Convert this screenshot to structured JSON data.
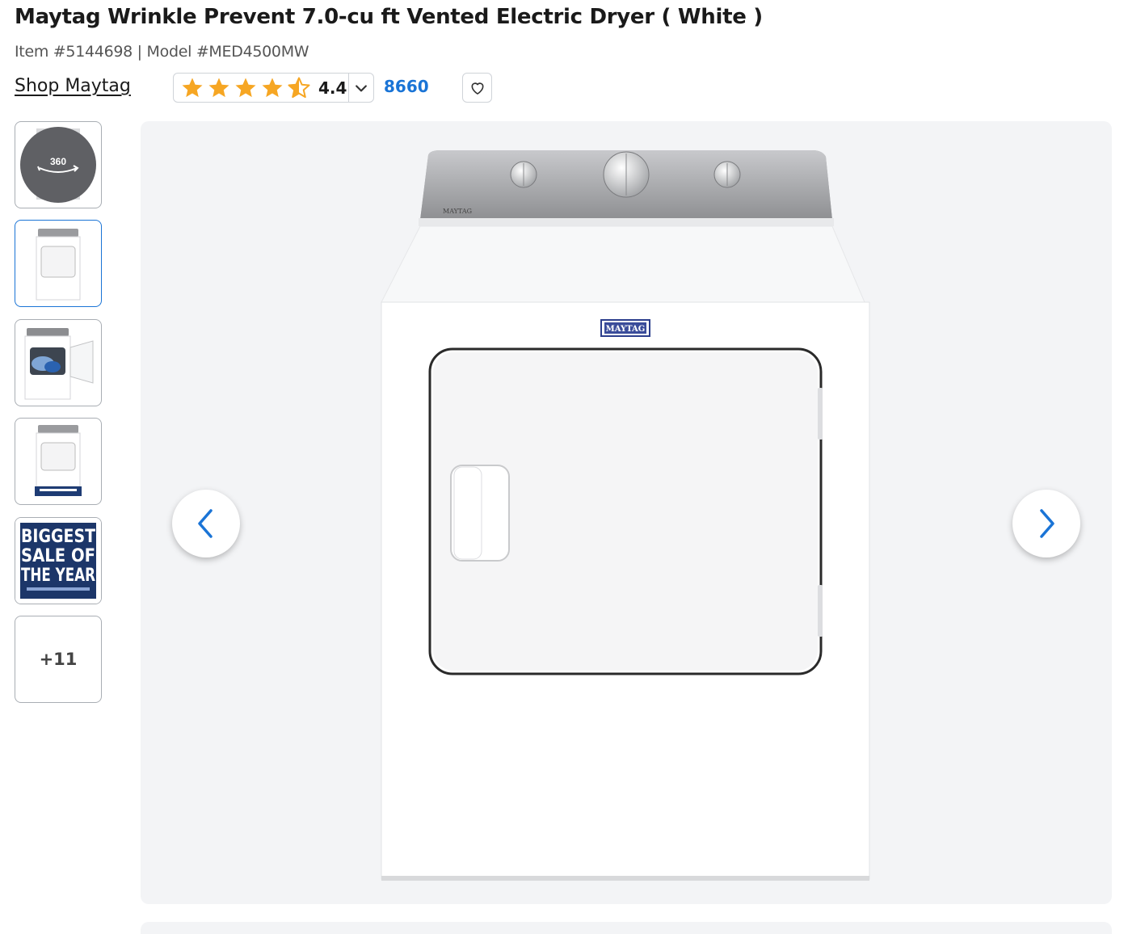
{
  "product": {
    "title": "Maytag Wrinkle Prevent 7.0-cu ft Vented Electric Dryer ( White )",
    "item_number": "Item #5144698",
    "separator": " | ",
    "model_number": "Model #MED4500MW",
    "brand_link": "Shop Maytag",
    "brand_logo_text": "MAYTAG"
  },
  "rating": {
    "value": "4.4",
    "stars": 4.4,
    "star_color": "#f6a623",
    "review_count": "8660"
  },
  "thumbnails": [
    {
      "name": "thumb-360",
      "label": "360"
    },
    {
      "name": "thumb-front",
      "label": ""
    },
    {
      "name": "thumb-open",
      "label": ""
    },
    {
      "name": "thumb-sale",
      "label": ""
    },
    {
      "name": "thumb-banner",
      "lines": [
        "BIGGEST",
        "SALE OF",
        "THE YEAR"
      ]
    },
    {
      "name": "thumb-more",
      "label": "+11"
    }
  ],
  "colors": {
    "accent": "#1a74d6",
    "hero_bg": "#f3f4f6"
  },
  "icons": {
    "favorite": "heart-icon",
    "prev": "chevron-left-icon",
    "next": "chevron-right-icon",
    "rating_dropdown": "chevron-down-icon"
  }
}
